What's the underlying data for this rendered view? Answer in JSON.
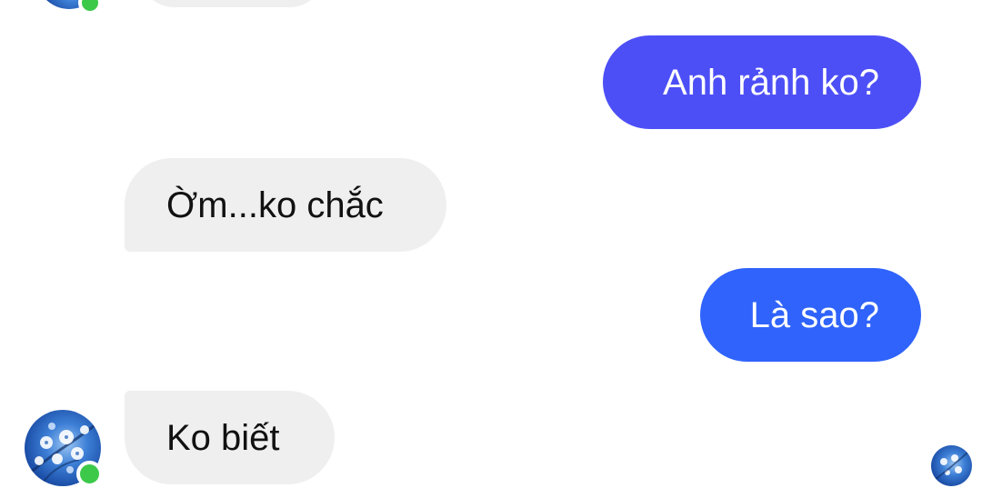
{
  "conversation": {
    "messages": [
      {
        "direction": "incoming",
        "text": ""
      },
      {
        "direction": "outgoing",
        "text": "Anh rảnh ko?"
      },
      {
        "direction": "incoming",
        "text": "Ờm...ko chắc"
      },
      {
        "direction": "outgoing",
        "text": "Là sao?"
      },
      {
        "direction": "incoming",
        "text": "Ko biết"
      }
    ]
  },
  "colors": {
    "incoming_bubble": "#efefef",
    "outgoing_bubble_1": "#4d4ff6",
    "outgoing_bubble_2": "#2f63fb",
    "online_status": "#3cc94a"
  },
  "icons": {
    "avatar": "avatar-photo",
    "online": "online-status-dot",
    "read_receipt": "seen-avatar-icon"
  }
}
